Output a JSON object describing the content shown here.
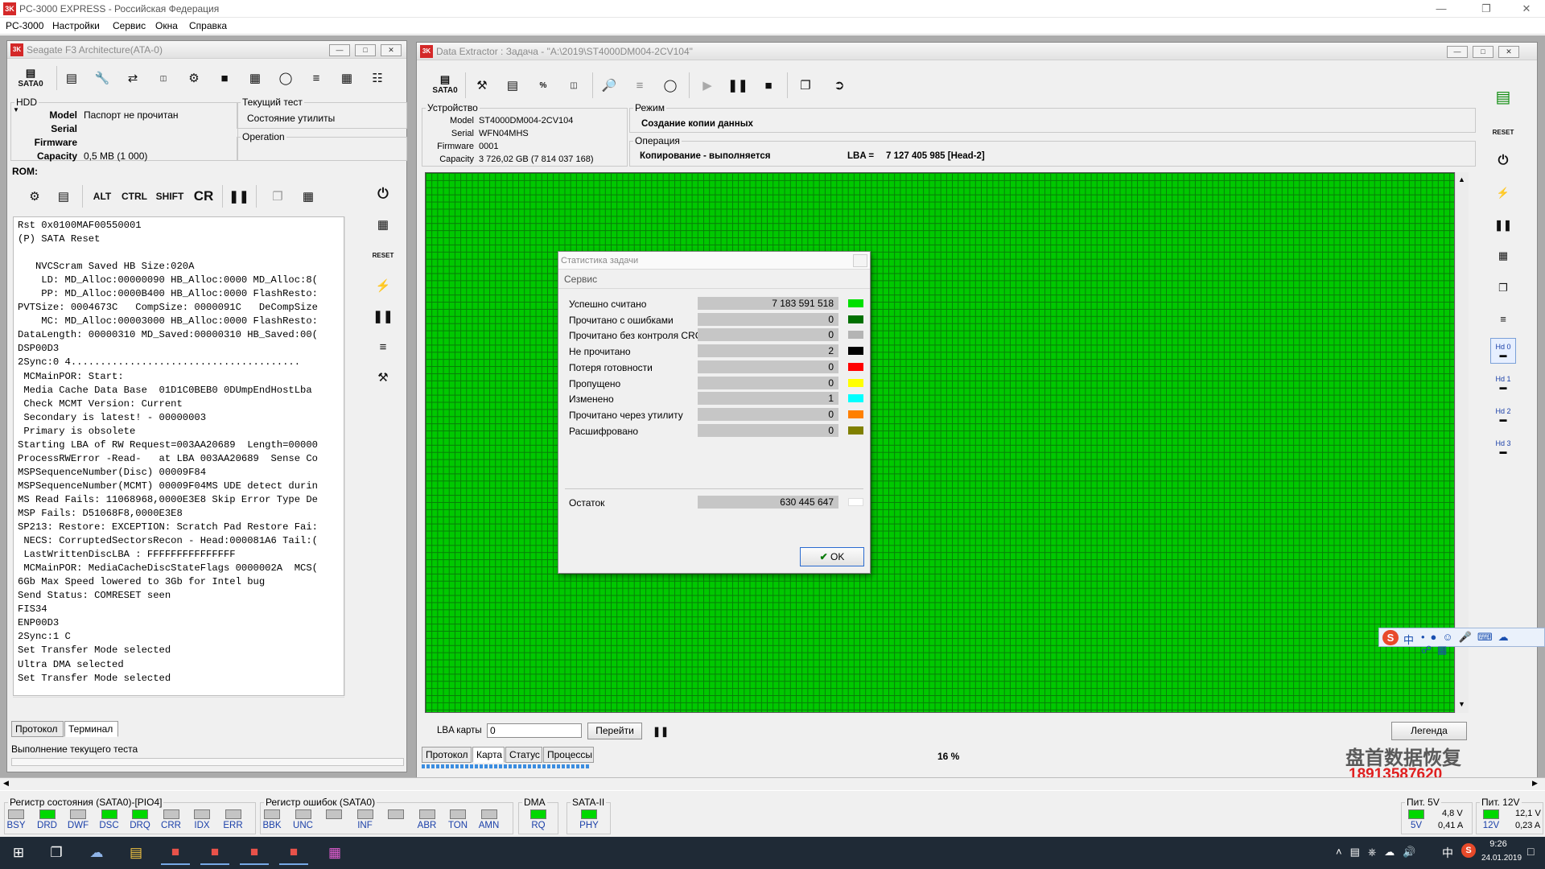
{
  "app": {
    "title": "PC-3000 EXPRESS - Российская Федерация",
    "menu": [
      "PC-3000",
      "Настройки",
      "Сервис",
      "Окна",
      "Справка"
    ]
  },
  "left_window": {
    "title": "Seagate F3 Architecture(ATA-0)",
    "toolbar_first": "SATA0",
    "hdd": {
      "legend": "HDD",
      "rows": [
        {
          "label": "Model",
          "value": "Паспорт не прочитан"
        },
        {
          "label": "Serial",
          "value": ""
        },
        {
          "label": "Firmware",
          "value": ""
        },
        {
          "label": "Capacity",
          "value": "0,5 MB (1 000)"
        }
      ]
    },
    "current_test": {
      "legend": "Текущий тест",
      "value": "Состояние утилиты"
    },
    "operation": {
      "legend": "Operation",
      "value": ""
    },
    "rom_label": "ROM:",
    "term_buttons": [
      "ALT",
      "CTRL",
      "SHIFT",
      "CR"
    ],
    "side_tools": {
      "reset": "RESET"
    },
    "log_lines": [
      "Rst 0x0100MAF00550001",
      "(P) SATA Reset",
      "",
      "   NVCScram Saved HB Size:020A",
      "    LD: MD_Alloc:00000090 HB_Alloc:0000 MD_Alloc:8(",
      "    PP: MD_Alloc:0000B400 HB_Alloc:0000 FlashResto:",
      "PVTSize: 0004673C   CompSize: 0000091C   DeCompSize",
      "    MC: MD_Alloc:00003000 HB_Alloc:0000 FlashResto:",
      "DataLength: 00000310 MD_Saved:00000310 HB_Saved:00(",
      "DSP00D3",
      "2Sync:0 4.......................................",
      " MCMainPOR: Start:",
      " Media Cache Data Base  01D1C0BEB0 0DUmpEndHostLba",
      " Check MCMT Version: Current",
      " Secondary is latest! - 00000003",
      " Primary is obsolete",
      "Starting LBA of RW Request=003AA20689  Length=00000",
      "ProcessRWError -Read-   at LBA 003AA20689  Sense Co",
      "MSPSequenceNumber(Disc) 00009F84",
      "MSPSequenceNumber(MCMT) 00009F04MS UDE detect durin",
      "MS Read Fails: 11068968,0000E3E8 Skip Error Type De",
      "MSP Fails: D51068F8,0000E3E8",
      "SP213: Restore: EXCEPTION: Scratch Pad Restore Fai:",
      " NECS: CorruptedSectorsRecon - Head:000081A6 Tail:(",
      " LastWrittenDiscLBA : FFFFFFFFFFFFFFF",
      " MCMainPOR: MediaCacheDiscStateFlags 0000002A  MCS(",
      "6Gb Max Speed lowered to 3Gb for Intel bug",
      "Send Status: COMRESET seen",
      "FIS34",
      "ENP00D3",
      "2Sync:1 C",
      "Set Transfer Mode selected",
      "Ultra DMA selected",
      "Set Transfer Mode selected"
    ],
    "tabs": [
      "Протокол",
      "Терминал"
    ],
    "status": "Выполнение текущего теста"
  },
  "extractor": {
    "title": "Data Extractor : Задача - \"A:\\2019\\ST4000DM004-2CV104\"",
    "toolbar_first": "SATA0",
    "device": {
      "legend": "Устройство",
      "rows": [
        {
          "label": "Model",
          "value": "ST4000DM004-2CV104"
        },
        {
          "label": "Serial",
          "value": "WFN04MHS"
        },
        {
          "label": "Firmware",
          "value": "0001"
        },
        {
          "label": "Capacity",
          "value": "3 726,02 GB (7 814 037 168)"
        }
      ]
    },
    "mode": {
      "legend": "Режим",
      "value": "Создание копии данных"
    },
    "operation": {
      "legend": "Операция",
      "value": "Копирование - выполняется",
      "lba_label": "LBA =",
      "lba_value": "7 127 405 985  [Head-2]"
    },
    "lba_map_label": "LBA карты",
    "lba_map_value": "0",
    "goto_button": "Перейти",
    "legend_button": "Легенда",
    "tabs": [
      "Протокол",
      "Карта",
      "Статус",
      "Процессы"
    ],
    "progress": "16 %",
    "side_heads": [
      "Hd 0",
      "Hd 1",
      "Hd 2",
      "Hd 3"
    ],
    "side_reset": "RESET"
  },
  "stats_dialog": {
    "title": "Статистика задачи",
    "section": "Сервис",
    "rows": [
      {
        "label": "Успешно считано",
        "value": "7 183 591 518",
        "color": "#00e000"
      },
      {
        "label": "Прочитано с ошибками",
        "value": "0",
        "color": "#007000"
      },
      {
        "label": "Прочитано без контроля CRC",
        "value": "0",
        "color": "#b4b4b4"
      },
      {
        "label": "Не прочитано",
        "value": "2",
        "color": "#000000"
      },
      {
        "label": "Потеря готовности",
        "value": "0",
        "color": "#ff0000"
      },
      {
        "label": "Пропущено",
        "value": "0",
        "color": "#ffff00"
      },
      {
        "label": "Изменено",
        "value": "1",
        "color": "#00ffff"
      },
      {
        "label": "Прочитано через утилиту",
        "value": "0",
        "color": "#ff8000"
      },
      {
        "label": "Расшифровано",
        "value": "0",
        "color": "#808000"
      }
    ],
    "remainder": {
      "label": "Остаток",
      "value": "630 445 647",
      "color": "#ffffff"
    },
    "ok_button": "OK"
  },
  "watermark": {
    "line1": "盘首数据恢复",
    "line2": "18913587620"
  },
  "status_panel": {
    "state_register": {
      "legend": "Регистр состояния (SATA0)-[PIO4]",
      "leds": [
        {
          "label": "BSY",
          "on": false
        },
        {
          "label": "DRD",
          "on": true
        },
        {
          "label": "DWF",
          "on": false
        },
        {
          "label": "DSC",
          "on": true
        },
        {
          "label": "DRQ",
          "on": true
        },
        {
          "label": "CRR",
          "on": false
        },
        {
          "label": "IDX",
          "on": false
        },
        {
          "label": "ERR",
          "on": false
        }
      ]
    },
    "error_register": {
      "legend": "Регистр ошибок  (SATA0)",
      "leds": [
        {
          "label": "BBK",
          "on": false
        },
        {
          "label": "UNC",
          "on": false
        },
        {
          "label": "",
          "on": false
        },
        {
          "label": "INF",
          "on": false
        },
        {
          "label": "",
          "on": false
        },
        {
          "label": "ABR",
          "on": false
        },
        {
          "label": "TON",
          "on": false
        },
        {
          "label": "AMN",
          "on": false
        }
      ]
    },
    "dma": {
      "legend": "DMA",
      "label": "RQ",
      "on": true
    },
    "sata": {
      "legend": "SATA-II",
      "label": "PHY",
      "on": true
    },
    "power5": {
      "legend": "Пит. 5V",
      "label": "5V",
      "v": "4,8 V",
      "a": "0,41 A"
    },
    "power12": {
      "legend": "Пит. 12V",
      "label": "12V",
      "v": "12,1 V",
      "a": "0,23 A"
    }
  },
  "taskbar": {
    "time": "9:26",
    "date": "24.01.2019",
    "lang": "中"
  },
  "colors": {
    "map_green": "#00c800",
    "led_on": "#00d800",
    "led_off": "#c4c4c4"
  }
}
